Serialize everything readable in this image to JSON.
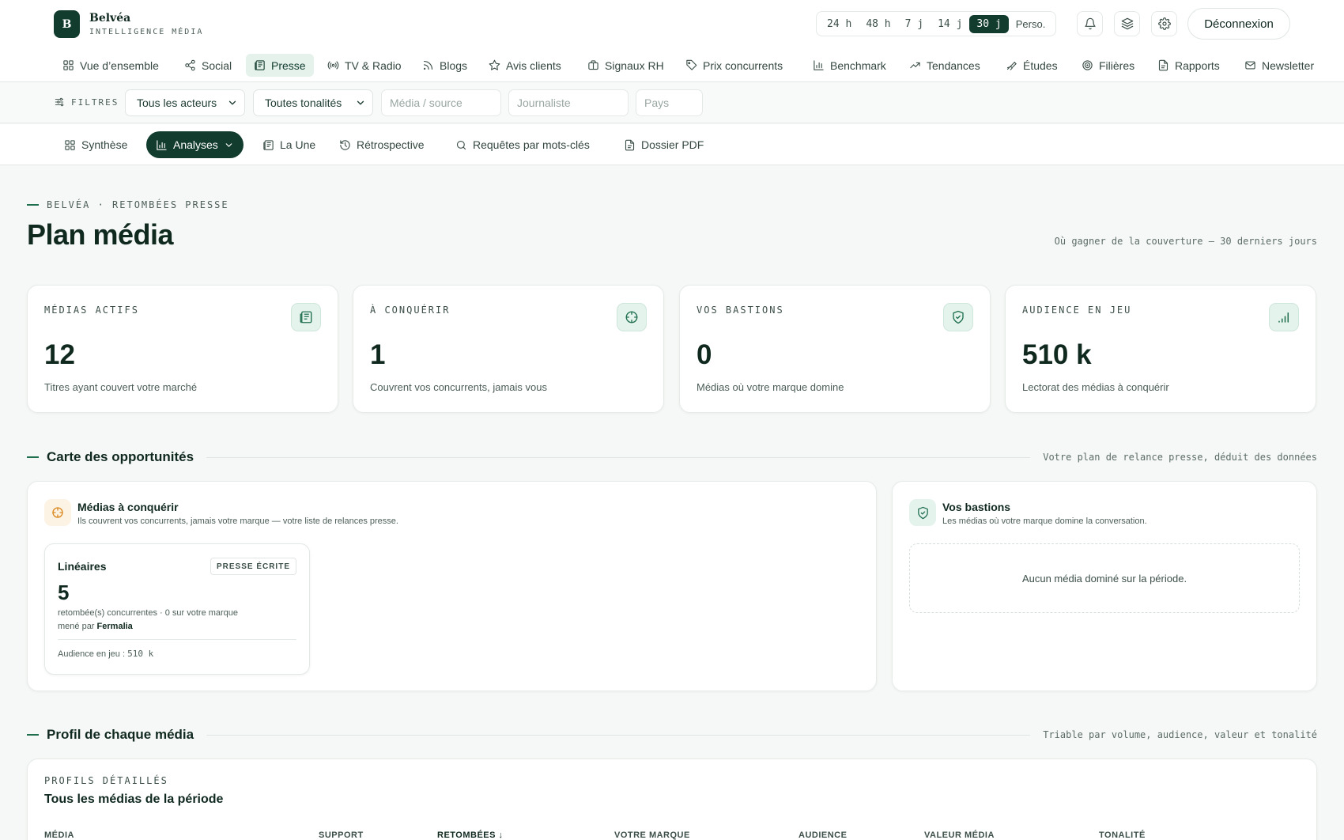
{
  "brand": {
    "initial": "B",
    "name": "Belvéa",
    "subtitle": "INTELLIGENCE MÉDIA"
  },
  "period": {
    "options": [
      "24 h",
      "48 h",
      "7 j",
      "14 j",
      "30 j",
      "Perso."
    ],
    "selected": "30 j"
  },
  "header": {
    "logout_label": "Déconnexion"
  },
  "nav": {
    "items": [
      {
        "label": "Vue d’ensemble",
        "icon": "grid-icon"
      },
      {
        "label": "Social",
        "icon": "share-icon"
      },
      {
        "label": "Presse",
        "icon": "newspaper-icon"
      },
      {
        "label": "TV & Radio",
        "icon": "broadcast-icon"
      },
      {
        "label": "Blogs",
        "icon": "rss-icon"
      },
      {
        "label": "Avis clients",
        "icon": "star-icon"
      },
      {
        "label": "Signaux RH",
        "icon": "briefcase-icon"
      },
      {
        "label": "Prix concurrents",
        "icon": "tag-icon"
      },
      {
        "label": "Benchmark",
        "icon": "bar-chart-icon"
      },
      {
        "label": "Tendances",
        "icon": "trend-icon"
      },
      {
        "label": "Études",
        "icon": "telescope-icon"
      },
      {
        "label": "Filières",
        "icon": "target-icon"
      },
      {
        "label": "Rapports",
        "icon": "file-icon"
      },
      {
        "label": "Newsletter",
        "icon": "mail-icon"
      }
    ],
    "active": "Presse"
  },
  "filters": {
    "label": "FILTRES",
    "actors": "Tous les acteurs",
    "tone": "Toutes tonalités",
    "media_placeholder": "Média / source",
    "journalist_placeholder": "Journaliste",
    "country_placeholder": "Pays"
  },
  "subnav": {
    "items": [
      {
        "label": "Synthèse",
        "icon": "grid-icon"
      },
      {
        "label": "Analyses",
        "icon": "bar-chart-icon"
      },
      {
        "label": "La Une",
        "icon": "newspaper-icon"
      },
      {
        "label": "Rétrospective",
        "icon": "history-icon"
      },
      {
        "label": "Requêtes par mots-clés",
        "icon": "search-icon"
      },
      {
        "label": "Dossier PDF",
        "icon": "file-icon"
      }
    ],
    "active": "Analyses"
  },
  "page": {
    "eyebrow": "BELVÉA · RETOMBÉES PRESSE",
    "title": "Plan média",
    "hint": "Où gagner de la couverture — 30 derniers jours"
  },
  "kpis": [
    {
      "label": "MÉDIAS ACTIFS",
      "value": "12",
      "desc": "Titres ayant couvert votre marché",
      "icon": "newspaper-icon"
    },
    {
      "label": "À CONQUÉRIR",
      "value": "1",
      "desc": "Couvrent vos concurrents, jamais vous",
      "icon": "crosshair-icon"
    },
    {
      "label": "VOS BASTIONS",
      "value": "0",
      "desc": "Médias où votre marque domine",
      "icon": "shield-icon"
    },
    {
      "label": "AUDIENCE EN JEU",
      "value": "510 k",
      "desc": "Lectorat des médias à conquérir",
      "icon": "signal-icon"
    }
  ],
  "opportunities": {
    "title": "Carte des opportunités",
    "hint": "Votre plan de relance presse, déduit des données",
    "conquer": {
      "title": "Médias à conquérir",
      "subtitle": "Ils couvrent vos concurrents, jamais votre marque — votre liste de relances presse.",
      "cards": [
        {
          "name": "Linéaires",
          "badge": "PRESSE ÉCRITE",
          "count": "5",
          "line1": "retombée(s) concurrentes · 0 sur votre marque",
          "led_prefix": "mené par",
          "led_by": "Fermalia",
          "audience_label": "Audience en jeu :",
          "audience_value": "510 k"
        }
      ]
    },
    "bastions": {
      "title": "Vos bastions",
      "subtitle": "Les médias où votre marque domine la conversation.",
      "empty": "Aucun média dominé sur la période."
    }
  },
  "profiles": {
    "title": "Profil de chaque média",
    "hint": "Triable par volume, audience, valeur et tonalité",
    "eyebrow": "PROFILS DÉTAILLÉS",
    "subtitle": "Tous les médias de la période",
    "columns": [
      "MÉDIA",
      "SUPPORT",
      "RETOMBÉES ↓",
      "VOTRE MARQUE",
      "AUDIENCE",
      "VALEUR MÉDIA",
      "TONALITÉ"
    ],
    "sorted_column": "RETOMBÉES ↓"
  },
  "colors": {
    "primary": "#123c2e",
    "accent_light": "#e4f3ec",
    "warning": "#d9871e",
    "background": "#f6f8f7"
  }
}
